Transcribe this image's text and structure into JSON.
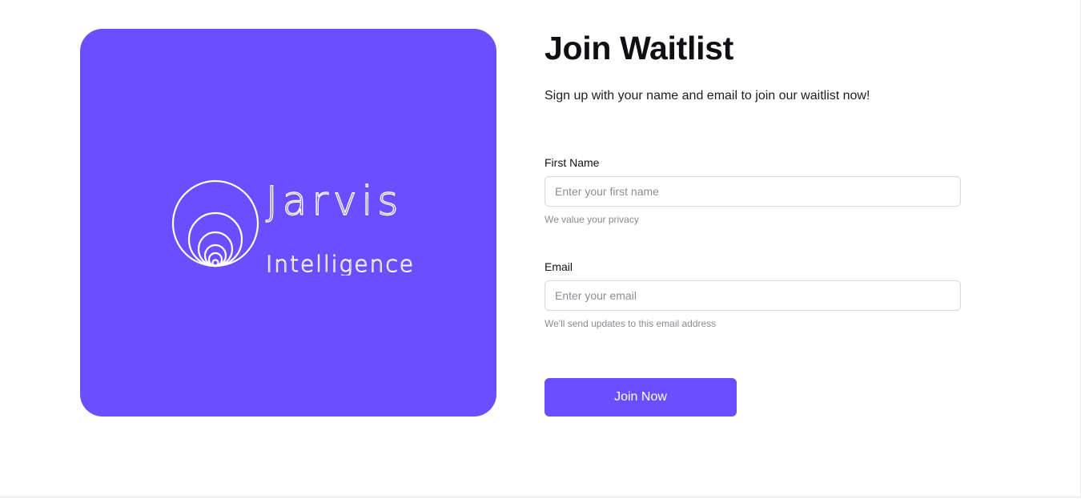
{
  "brand": {
    "name": "Jarvis",
    "tagline": "Intelligence",
    "accent": "#6b4fff",
    "logo_icon": "concentric-circles-logo"
  },
  "form": {
    "title": "Join Waitlist",
    "subtitle": "Sign up with your name and email to join our waitlist now!",
    "first_name": {
      "label": "First Name",
      "placeholder": "Enter your first name",
      "value": "",
      "hint": "We value your privacy"
    },
    "email": {
      "label": "Email",
      "placeholder": "Enter your email",
      "value": "",
      "hint": "We'll send updates to this email address"
    },
    "submit_label": "Join Now"
  }
}
